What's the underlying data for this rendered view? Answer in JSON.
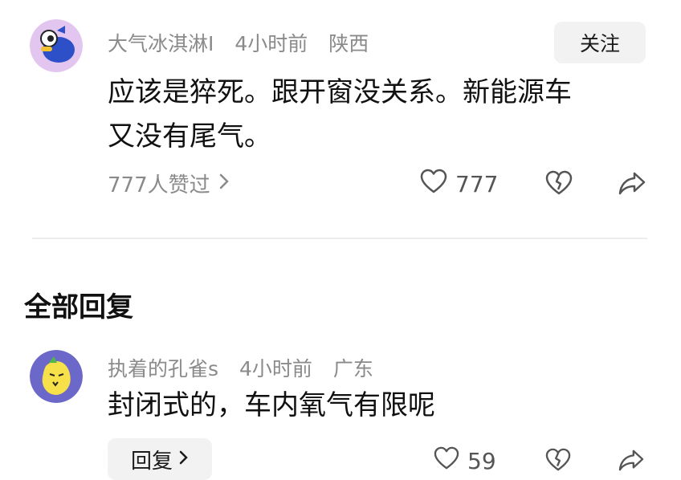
{
  "main_comment": {
    "username": "大气冰淇淋I",
    "time": "4小时前",
    "location": "陕西",
    "follow_label": "关注",
    "text_line1": "应该是猝死。跟开窗没关系。新能源车",
    "text_line2": "又没有尾气。",
    "likes_summary": "777人赞过",
    "like_count": "777"
  },
  "replies_section": {
    "title": "全部回复"
  },
  "reply": {
    "username": "执着的孔雀s",
    "time": "4小时前",
    "location": "广东",
    "text": "封闭式的，车内氧气有限呢",
    "reply_label": "回复",
    "like_count": "59"
  },
  "colors": {
    "background": "#ffffff",
    "text_primary": "#111111",
    "text_secondary": "#8a8a8a",
    "button_bg": "#f2f2f2",
    "avatar1_bg": "#e3c6f0",
    "avatar2_bg": "#6b68c9"
  },
  "icons": [
    "heart-icon",
    "broken-heart-icon",
    "share-icon",
    "chevron-right-icon"
  ]
}
